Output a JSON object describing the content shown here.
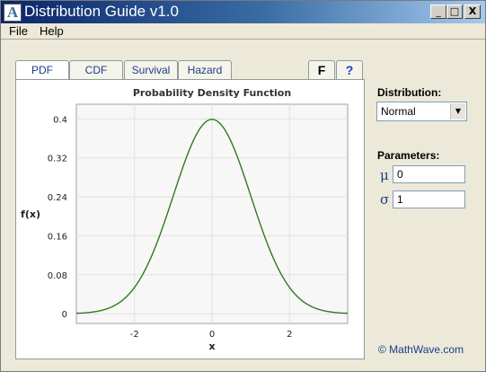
{
  "window": {
    "title": "Distribution Guide v1.0",
    "icon_letter": "A",
    "controls": {
      "minimize": "_",
      "maximize": "□",
      "close": "X"
    }
  },
  "menu": {
    "file": "File",
    "help": "Help"
  },
  "tabs": [
    "PDF",
    "CDF",
    "Survival",
    "Hazard"
  ],
  "small_tabs": {
    "f": "F",
    "help": "?"
  },
  "sidebar": {
    "distribution_label": "Distribution:",
    "distribution_value": "Normal",
    "parameters_label": "Parameters:",
    "params": [
      {
        "symbol": "μ",
        "value": "0"
      },
      {
        "symbol": "σ",
        "value": "1"
      }
    ]
  },
  "footer": "© MathWave.com",
  "chart_data": {
    "type": "line",
    "title": "Probability Density Function",
    "xlabel": "x",
    "ylabel": "f(x)",
    "xlim": [
      -3.5,
      3.5
    ],
    "ylim": [
      -0.02,
      0.43
    ],
    "xticks": [
      -2,
      0,
      2
    ],
    "yticks": [
      0,
      0.08,
      0.16,
      0.24,
      0.32,
      0.4
    ],
    "grid": true,
    "series": [
      {
        "function": "normal_pdf",
        "mu": 0,
        "sigma": 1,
        "color": "#2E7D1E"
      }
    ]
  }
}
